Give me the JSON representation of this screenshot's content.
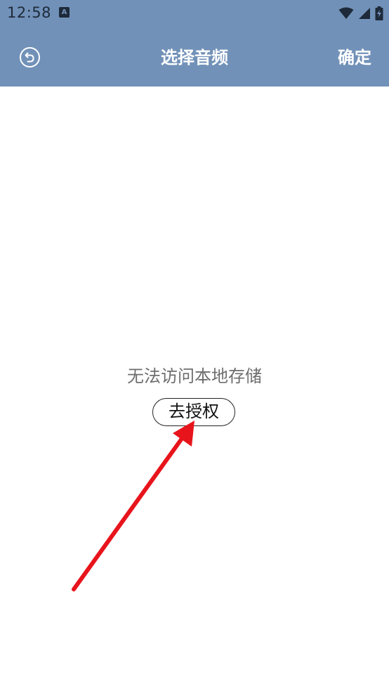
{
  "status_bar": {
    "time": "12:58",
    "notification_icon": "a-letter-icon",
    "icons": [
      "wifi-icon",
      "signal-icon",
      "battery-charging-icon"
    ]
  },
  "header": {
    "back_icon": "back-circle-icon",
    "title": "选择音频",
    "confirm_label": "确定"
  },
  "main": {
    "empty_message": "无法访问本地存储",
    "authorize_label": "去授权"
  },
  "annotation": {
    "type": "red-arrow",
    "color": "#e8141c"
  },
  "colors": {
    "header_bg": "#7191b8",
    "header_text": "#ffffff",
    "message_text": "#6e6e6e"
  }
}
